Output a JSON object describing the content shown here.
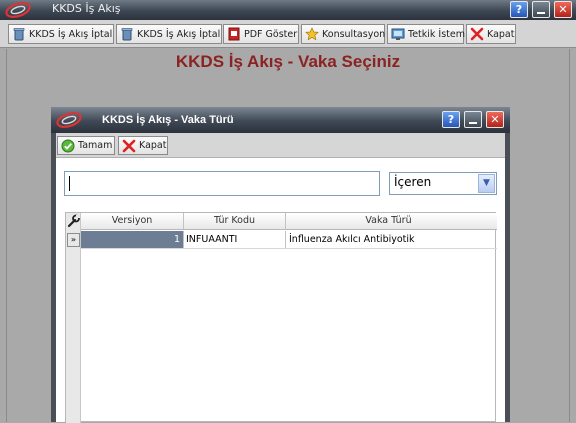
{
  "app": {
    "title": "KKDS İş Akış",
    "window_controls": [
      "help-icon",
      "minimize-icon",
      "close-icon"
    ]
  },
  "toolbar": {
    "buttons": [
      {
        "label": "KKDS İş Akış İptal",
        "icon": "recycle-bin-icon"
      },
      {
        "label": "KKDS İş Akış İptal",
        "icon": "recycle-bin-icon"
      },
      {
        "label": "PDF Göster",
        "icon": "pdf-icon"
      },
      {
        "label": "Konsultasyon",
        "icon": "star-icon"
      },
      {
        "label": "Tetkik İstem",
        "icon": "monitor-icon"
      },
      {
        "label": "Kapat",
        "icon": "close-x-icon"
      }
    ]
  },
  "main": {
    "heading": "KKDS İş Akış - Vaka Seçiniz"
  },
  "dialog": {
    "title": "KKDS İş Akış - Vaka Türü",
    "toolbar": {
      "ok_label": "Tamam",
      "close_label": "Kapat"
    },
    "search": {
      "value": "",
      "filter_selected": "İçeren"
    },
    "grid": {
      "columns": [
        "Versiyon",
        "Tür Kodu",
        "Vaka Türü"
      ],
      "rows": [
        {
          "versiyon": "1",
          "tur_kodu": "INFUAANTI",
          "vaka_turu": "İnfluenza Akılcı Antibiyotik"
        }
      ]
    }
  },
  "colors": {
    "heading": "#8b2323",
    "selected_cell": "#6d7d93",
    "titlebar": "#3d4653"
  }
}
